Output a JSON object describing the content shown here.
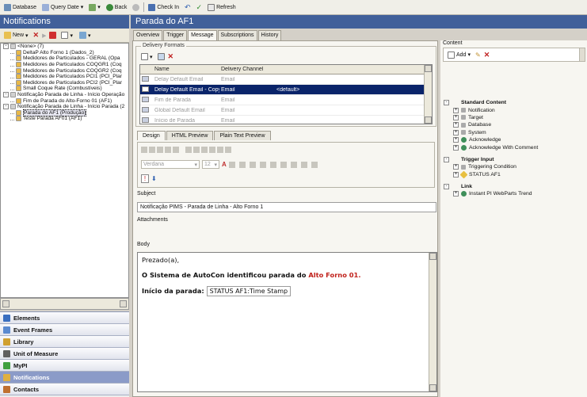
{
  "toolbar": {
    "database": "Database",
    "query_date": "Query Date",
    "back": "Back",
    "check_in": "Check In",
    "refresh": "Refresh"
  },
  "left": {
    "title": "Notifications",
    "new_label": "New",
    "tree": [
      {
        "label": "<None> (7)",
        "indent": 0,
        "expander": "-",
        "sel": false
      },
      {
        "label": "DeltaP Alto Forno 1 (Dados_2)",
        "indent": 1,
        "expander": "",
        "sel": false
      },
      {
        "label": "Medidores de Particulados - GERAL (Opa",
        "indent": 1,
        "expander": "",
        "sel": false
      },
      {
        "label": "Medidores de Particulados COQGR1 (Coq",
        "indent": 1,
        "expander": "",
        "sel": false
      },
      {
        "label": "Medidores de Particulados COQGR2 (Coq",
        "indent": 1,
        "expander": "",
        "sel": false
      },
      {
        "label": "Medidores de Particulados PCI1 (PCI_Plar",
        "indent": 1,
        "expander": "",
        "sel": false
      },
      {
        "label": "Medidores de Particulados PCI2 (PCI_Plar",
        "indent": 1,
        "expander": "",
        "sel": false
      },
      {
        "label": "Small Coque Rate (Combustíveis)",
        "indent": 1,
        "expander": "",
        "sel": false
      },
      {
        "label": "Notificação Parada de Linha - Início Operação",
        "indent": 0,
        "expander": "-",
        "sel": false
      },
      {
        "label": "Fim de Parada do Alto-Forno 01 (AF1)",
        "indent": 1,
        "expander": "",
        "sel": false
      },
      {
        "label": "Notificação Parada de Linha - Início Parada (2",
        "indent": 0,
        "expander": "-",
        "sel": false
      },
      {
        "label": "Parada do AF1 (Produção)",
        "indent": 1,
        "expander": "",
        "sel": true
      },
      {
        "label": "Teste Parada AF01 (AF1)",
        "indent": 1,
        "expander": "",
        "sel": false
      }
    ],
    "nav": [
      {
        "label": "Elements",
        "color": "#3a6fc0",
        "active": false
      },
      {
        "label": "Event Frames",
        "color": "#5a8ad0",
        "active": false
      },
      {
        "label": "Library",
        "color": "#d0a030",
        "active": false
      },
      {
        "label": "Unit of Measure",
        "color": "#606060",
        "active": false
      },
      {
        "label": "MyPI",
        "color": "#40a040",
        "active": false
      },
      {
        "label": "Notifications",
        "color": "#e0b040",
        "active": true
      },
      {
        "label": "Contacts",
        "color": "#c07030",
        "active": false
      }
    ]
  },
  "right": {
    "title": "Parada do AF1",
    "tabs": [
      {
        "label": "Overview",
        "active": false
      },
      {
        "label": "Trigger",
        "active": false
      },
      {
        "label": "Message",
        "active": true
      },
      {
        "label": "Subscriptions",
        "active": false
      },
      {
        "label": "History",
        "active": false
      }
    ],
    "delivery": {
      "legend": "Delivery Formats",
      "col_name": "Name",
      "col_channel": "Delivery Channel",
      "rows": [
        {
          "name": "Delay Default Email",
          "channel": "Email",
          "extra": "",
          "sel": false
        },
        {
          "name": "Delay Default Email - Copy",
          "channel": "Email",
          "extra": "<default>",
          "sel": true
        },
        {
          "name": "Fim de Parada",
          "channel": "Email",
          "extra": "",
          "sel": false
        },
        {
          "name": "Global Default Email",
          "channel": "Email",
          "extra": "",
          "sel": false
        },
        {
          "name": "Início de Parada",
          "channel": "Email",
          "extra": "",
          "sel": false
        }
      ]
    },
    "editor_tabs": [
      {
        "label": "Design",
        "active": true
      },
      {
        "label": "HTML Preview",
        "active": false
      },
      {
        "label": "Plain Text Preview",
        "active": false
      }
    ],
    "font_name": "Verdana",
    "font_size": "12",
    "subject_label": "Subject",
    "subject_value": "Notificação PIMS - Parada de Linha - Alto Forno 1",
    "attachments_label": "Attachments",
    "body_label": "Body",
    "body": {
      "greeting": "Prezado(a),",
      "line2_prefix": "O Sistema de AutoCon identificou parada do ",
      "line2_highlight": "Alto Forno 01.",
      "line3_label": "Início da parada:",
      "stamp": "STATUS AF1:Time Stamp"
    }
  },
  "content": {
    "title": "Content",
    "add_label": "Add",
    "items": [
      {
        "label": "Standard Content",
        "type": "group",
        "expander": "-"
      },
      {
        "label": "Notification",
        "type": "item",
        "expander": "+",
        "icon": "grey"
      },
      {
        "label": "Target",
        "type": "item",
        "expander": "+",
        "icon": "grey"
      },
      {
        "label": "Database",
        "type": "item",
        "expander": "+",
        "icon": "grey"
      },
      {
        "label": "System",
        "type": "item",
        "expander": "+",
        "icon": "grey"
      },
      {
        "label": "Acknowledge",
        "type": "item",
        "expander": "+",
        "icon": "globe"
      },
      {
        "label": "Acknowledge With Comment",
        "type": "item",
        "expander": "+",
        "icon": "globe"
      },
      {
        "label": "",
        "type": "gap",
        "expander": "",
        "icon": ""
      },
      {
        "label": "Trigger Input",
        "type": "group",
        "expander": "-"
      },
      {
        "label": "Triggering Condition",
        "type": "item",
        "expander": "+",
        "icon": "grey"
      },
      {
        "label": "STATUS AF1",
        "type": "item",
        "expander": "+",
        "icon": "tag"
      },
      {
        "label": "",
        "type": "gap",
        "expander": "",
        "icon": ""
      },
      {
        "label": "Link",
        "type": "group",
        "expander": "-"
      },
      {
        "label": "Instant PI WebParts Trend",
        "type": "item",
        "expander": "+",
        "icon": "globe"
      }
    ]
  }
}
